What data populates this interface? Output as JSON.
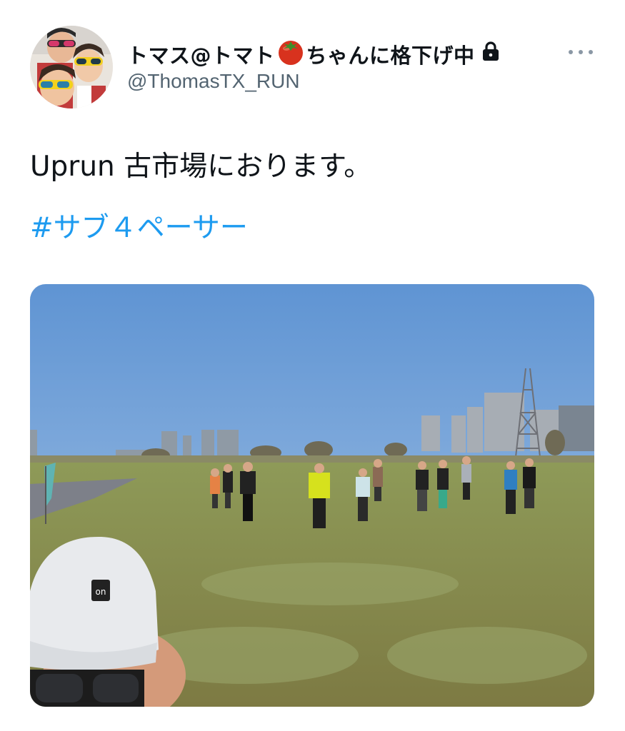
{
  "tweet": {
    "display_name_part1": "トマス@トマト",
    "display_name_part2": "ちゃんに格下げ中",
    "handle": "@ThomasTX_RUN",
    "text": "Uprun 古市場におります。",
    "hashtag": "#サブ４ペーサー",
    "icons": {
      "tomato": "tomato-emoji-icon",
      "lock": "lock-icon",
      "more": "more-options-icon"
    },
    "photo_cap_logo": "on"
  },
  "colors": {
    "link": "#1d9bf0",
    "handle": "#536471",
    "text": "#0f1419",
    "sky": "#6d9fd6",
    "grass": "#8b8a4b"
  }
}
